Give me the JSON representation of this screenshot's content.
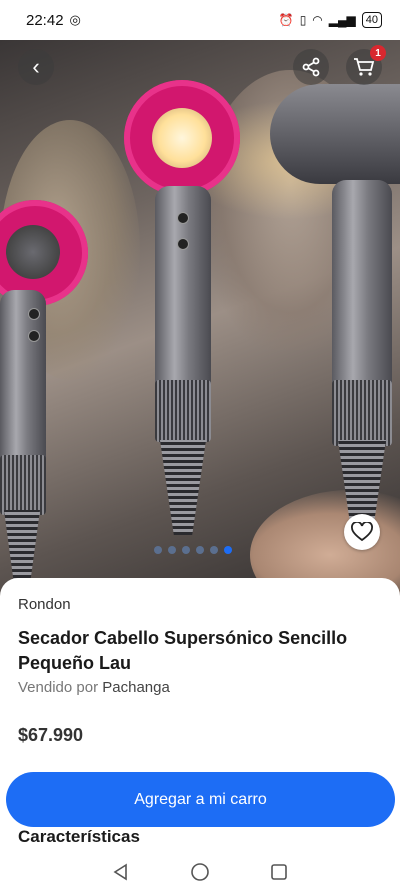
{
  "status_bar": {
    "time": "22:42",
    "battery": "40"
  },
  "header": {
    "cart_count": "1"
  },
  "carousel": {
    "total": 6,
    "active_index": 5
  },
  "product": {
    "brand": "Rondon",
    "title": "Secador Cabello Supersónico Sencillo Pequeño Lau",
    "seller_prefix": "Vendido por",
    "seller_name": "Pachanga",
    "price": "$67.990"
  },
  "actions": {
    "add_to_cart": "Agregar a mi carro"
  },
  "sections": {
    "features": "Características"
  },
  "colors": {
    "accent": "#1d6df5",
    "badge": "#d8282f",
    "dryer_pink": "#d2176e"
  }
}
